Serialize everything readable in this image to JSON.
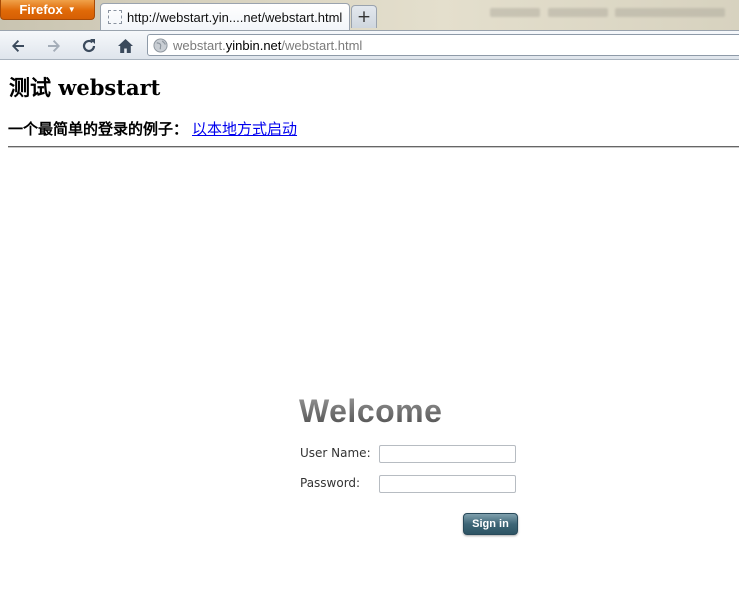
{
  "browser": {
    "app_button": "Firefox",
    "tab": {
      "title": "http://webstart.yin....net/webstart.html"
    },
    "new_tab_label": "+",
    "address": {
      "prefix": "webstart.",
      "domain": "yinbin.net",
      "path": "/webstart.html"
    }
  },
  "page": {
    "heading": "测试 webstart",
    "intro": "一个最简单的登录的例子：",
    "launch_link": "以本地方式启动"
  },
  "login": {
    "welcome": "Welcome",
    "username_label": "User Name:",
    "username_value": "",
    "password_label": "Password:",
    "password_value": "",
    "signin_label": "Sign in"
  },
  "colors": {
    "firefox_orange": "#e06a08",
    "link_blue": "#0000ee",
    "signin_teal": "#3e6677"
  }
}
